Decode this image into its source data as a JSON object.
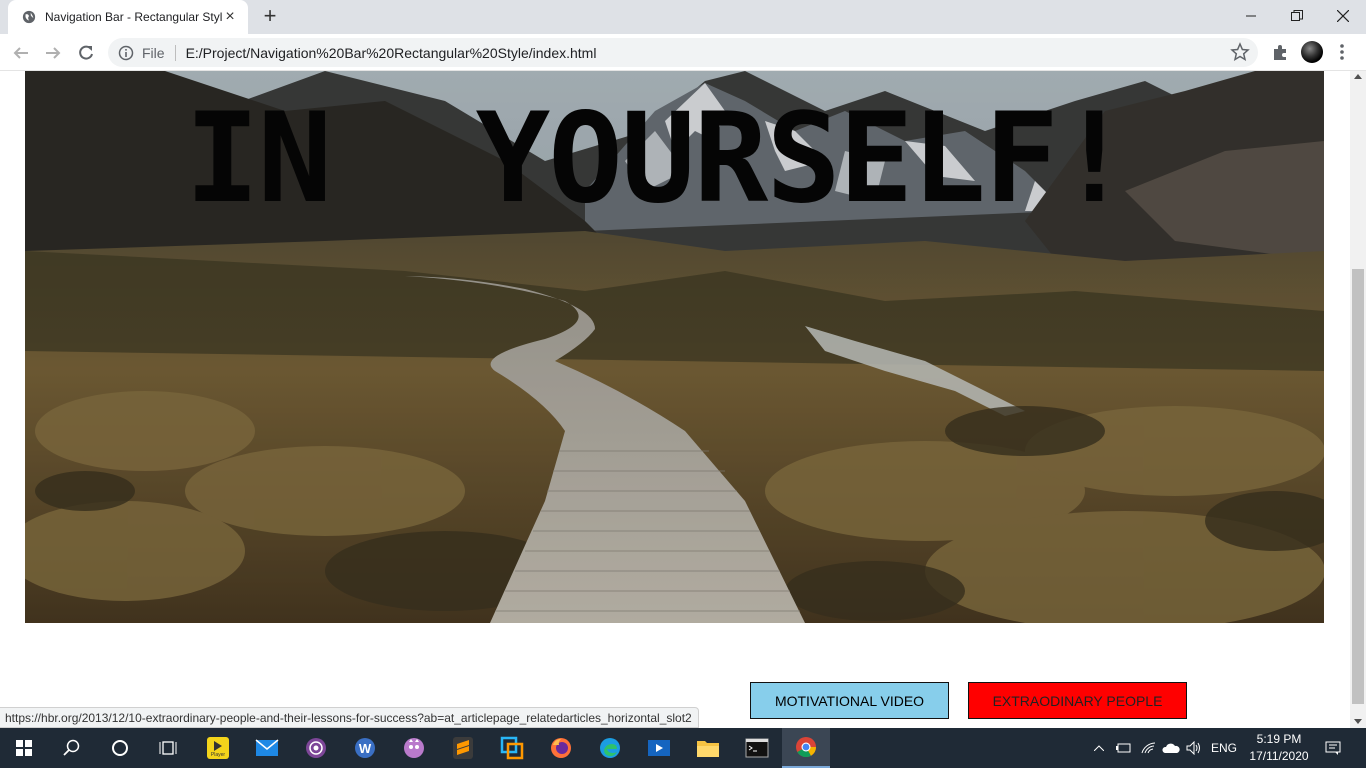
{
  "browser": {
    "tab_title": "Navigation Bar - Rectangular Style",
    "omnibox_scheme": "File",
    "url": "E:/Project/Navigation%20Bar%20Rectangular%20Style/index.html",
    "status_url": "https://hbr.org/2013/12/10-extraordinary-people-and-their-lessons-for-success?ab=at_articlepage_relatedarticles_horizontal_slot2"
  },
  "page": {
    "heading": "IN  YOURSELF!",
    "buttons": {
      "video_label": "MOTIVATIONAL VIDEO",
      "people_label": "EXTRAODINARY PEOPLE"
    },
    "colors": {
      "video_button": "#87ceeb",
      "people_button": "#ff0000"
    }
  },
  "taskbar": {
    "icons": [
      "windows-start-icon",
      "search-icon",
      "cortana-icon",
      "task-view-icon",
      "kmplayer-icon",
      "mail-icon",
      "tor-icon",
      "wps-writer-icon",
      "vlc-icon",
      "sublime-text-icon",
      "office-icon",
      "firefox-icon",
      "edge-icon",
      "media-player-icon",
      "file-explorer-icon",
      "command-prompt-icon",
      "chrome-icon"
    ],
    "player_label": "Player",
    "language": "ENG",
    "time": "5:19 PM",
    "date": "17/11/2020"
  }
}
